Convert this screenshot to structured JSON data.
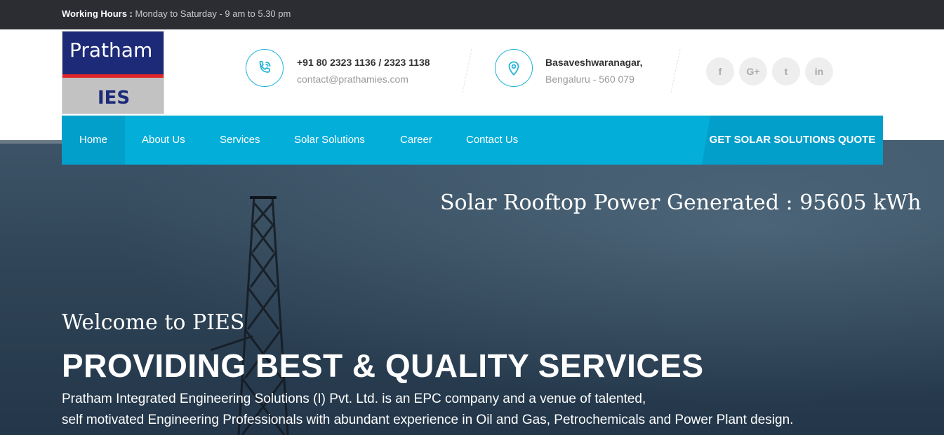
{
  "topbar": {
    "hours_label": "Working Hours :",
    "hours_value": " Monday to Saturday - 9 am to 5.30 pm"
  },
  "logo": {
    "line1": "Pratham",
    "line2": "IES"
  },
  "contact": {
    "phone": "+91 80 2323 1136 / 2323 1138",
    "email": "contact@prathamies.com",
    "phone_icon": "phone-icon"
  },
  "address": {
    "line1": "Basaveshwaranagar,",
    "line2": "Bengaluru - 560 079",
    "icon": "map-pin-icon"
  },
  "social": [
    {
      "label": "f",
      "icon": "facebook-icon"
    },
    {
      "label": "G+",
      "icon": "google-plus-icon"
    },
    {
      "label": "t",
      "icon": "twitter-icon"
    },
    {
      "label": "in",
      "icon": "linkedin-icon"
    }
  ],
  "nav": {
    "items": [
      "Home",
      "About Us",
      "Services",
      "Solar Solutions",
      "Career",
      "Contact Us"
    ],
    "active": "Home",
    "quote_button": "GET SOLAR SOLUTIONS QUOTE"
  },
  "hero": {
    "counter": "Solar Rooftop Power Generated : 95605 kWh",
    "welcome": "Welcome to PIES",
    "headline": "PROVIDING BEST & QUALITY SERVICES",
    "description_line1": "Pratham Integrated Engineering Solutions (I) Pvt. Ltd. is an EPC company and a venue of talented,",
    "description_line2": "self motivated Engineering Professionals with abundant experience in Oil and Gas, Petrochemicals and Power Plant design."
  },
  "colors": {
    "accent": "#03aed9",
    "accent_dark": "#039fcb",
    "topbar": "#2b2d33",
    "brand_navy": "#1c2a78",
    "brand_red": "#e0252a"
  }
}
